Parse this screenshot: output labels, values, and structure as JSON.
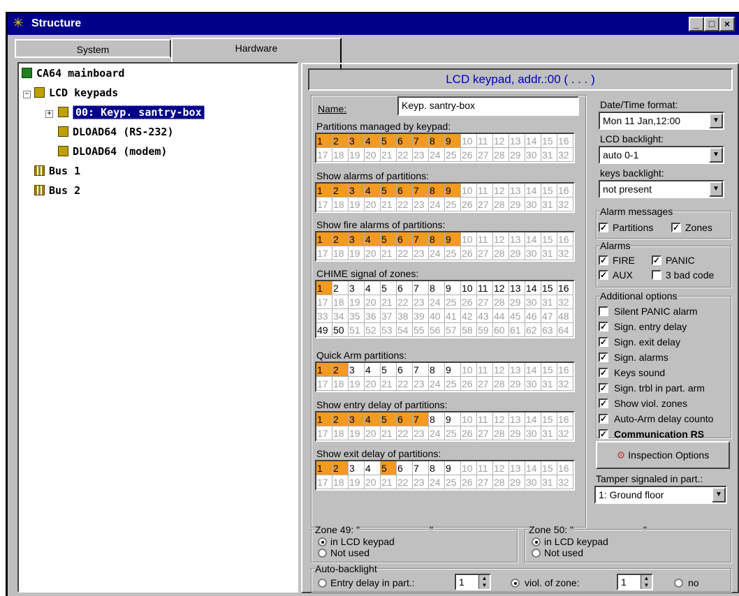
{
  "window": {
    "title": "Structure",
    "btn_min": "_",
    "btn_max": "□",
    "btn_close": "×"
  },
  "tabs": {
    "system": "System",
    "hardware": "Hardware"
  },
  "tree": {
    "mainboard": "CA64 mainboard",
    "lcd_keypads": "LCD keypads",
    "keypad_sel": "00: Keyp. santry-box",
    "dload_rs": "DLOAD64 (RS-232)",
    "dload_modem": "DLOAD64 (modem)",
    "bus1": "Bus 1",
    "bus2": "Bus 2"
  },
  "header": "LCD keypad, addr.:00 ( . . . )",
  "name": {
    "label": "Name:",
    "value": "Keyp. santry-box"
  },
  "groups": [
    {
      "label": "Partitions managed by keypad:",
      "on": [
        1,
        2,
        3,
        4,
        5,
        6,
        7,
        8,
        9
      ],
      "dark": []
    },
    {
      "label": "Show alarms of partitions:",
      "on": [
        1,
        2,
        3,
        4,
        5,
        6,
        7,
        8,
        9
      ],
      "dark": []
    },
    {
      "label": "Show fire alarms of partitions:",
      "on": [
        1,
        2,
        3,
        4,
        5,
        6,
        7,
        8,
        9
      ],
      "dark": []
    },
    {
      "label": "CHIME signal of zones:",
      "on": [
        1
      ],
      "dark": [
        2,
        3,
        4,
        5,
        6,
        7,
        8,
        9,
        10,
        11,
        12,
        13,
        14,
        15,
        16,
        49,
        50
      ]
    },
    {
      "label": "Quick Arm partitions:",
      "on": [
        1,
        2
      ],
      "dark": [
        3,
        4,
        5,
        6,
        7,
        8,
        9
      ]
    },
    {
      "label": "Show entry delay of partitions:",
      "on": [
        1,
        2,
        3,
        4,
        5,
        6,
        7
      ],
      "dark": [
        8,
        9
      ]
    },
    {
      "label": "Show exit delay of partitions:",
      "on": [
        1,
        2,
        5
      ],
      "dark": [
        3,
        4,
        6,
        7,
        8,
        9
      ]
    }
  ],
  "datetime": {
    "label": "Date/Time format:",
    "value": "Mon 11 Jan,12:00"
  },
  "lcd_backlight": {
    "label": "LCD backlight:",
    "value": "auto 0-1"
  },
  "keys_backlight": {
    "label": "keys backlight:",
    "value": "not present"
  },
  "alarm_messages": {
    "label": "Alarm messages",
    "partitions": "Partitions",
    "zones": "Zones"
  },
  "alarms": {
    "label": "Alarms",
    "fire": "FIRE",
    "panic": "PANIC",
    "aux": "AUX",
    "bad_code": "3 bad code"
  },
  "additional": {
    "label": "Additional options",
    "items": [
      {
        "text": "Silent PANIC alarm",
        "checked": false
      },
      {
        "text": "Sign. entry delay",
        "checked": true
      },
      {
        "text": "Sign. exit delay",
        "checked": true
      },
      {
        "text": "Sign. alarms",
        "checked": true
      },
      {
        "text": "Keys sound",
        "checked": true
      },
      {
        "text": "Sign. trbl in part. arm",
        "checked": true
      },
      {
        "text": "Show viol. zones",
        "checked": true
      },
      {
        "text": "Auto-Arm delay counto",
        "checked": true
      },
      {
        "text": "Communication RS",
        "checked": true
      }
    ]
  },
  "inspection_button": "Inspection Options",
  "tamper": {
    "label": "Tamper signaled in part.:",
    "value": "1: Ground floor"
  },
  "zone49": {
    "label": "Zone 49: \"",
    "quote": "\"",
    "in_lcd": "in LCD keypad",
    "not_used": "Not used"
  },
  "zone50": {
    "label": "Zone 50: \"",
    "quote": "\"",
    "in_lcd": "in LCD keypad",
    "not_used": "Not used"
  },
  "auto_backlight": {
    "label": "Auto-backlight",
    "entry": "Entry delay in part.:",
    "entry_val": "1",
    "viol": "viol. of zone:",
    "viol_val": "1",
    "no": "no"
  },
  "colors": {
    "selected_cell": "#f39a21",
    "title_bar": "#00008a",
    "header_text": "#0000c0"
  }
}
